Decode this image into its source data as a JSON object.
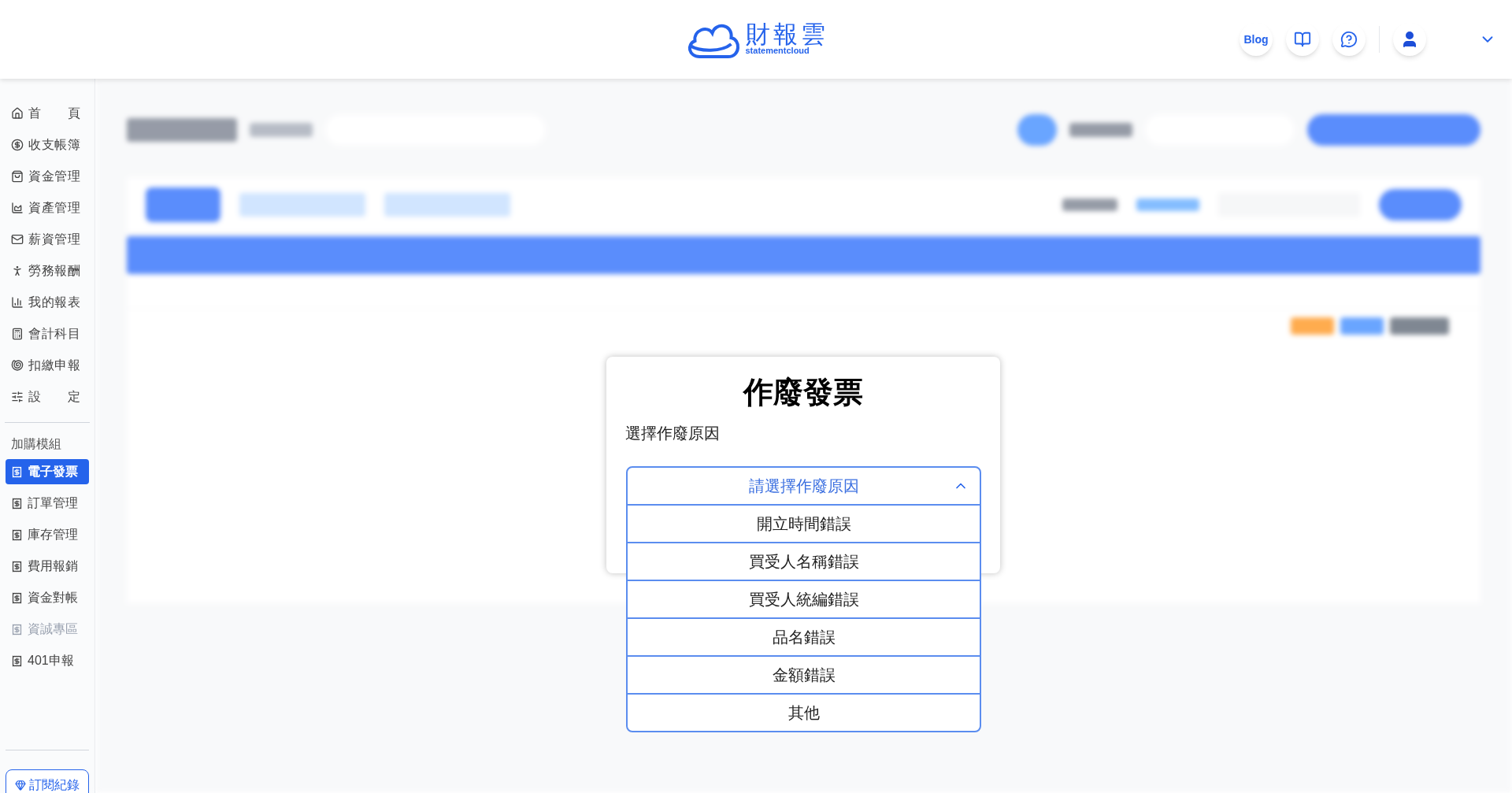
{
  "header": {
    "logo_name": "財報雲",
    "logo_sub": "statementcloud",
    "blog": "Blog"
  },
  "sidebar": {
    "items": [
      {
        "label": "首 頁",
        "selected": false,
        "disabled": false
      },
      {
        "label": "收支帳簿",
        "selected": false,
        "disabled": false
      },
      {
        "label": "資金管理",
        "selected": false,
        "disabled": false
      },
      {
        "label": "資產管理",
        "selected": false,
        "disabled": false
      },
      {
        "label": "薪資管理",
        "selected": false,
        "disabled": false
      },
      {
        "label": "勞務報酬",
        "selected": false,
        "disabled": false
      },
      {
        "label": "我的報表",
        "selected": false,
        "disabled": false
      },
      {
        "label": "會計科目",
        "selected": false,
        "disabled": false
      },
      {
        "label": "扣繳申報",
        "selected": false,
        "disabled": false
      },
      {
        "label": "設 定",
        "selected": false,
        "disabled": false
      }
    ],
    "module_heading": "加購模組",
    "modules": [
      {
        "label": "電子發票",
        "selected": true,
        "disabled": false
      },
      {
        "label": "訂單管理",
        "selected": false,
        "disabled": false
      },
      {
        "label": "庫存管理",
        "selected": false,
        "disabled": false
      },
      {
        "label": "費用報銷",
        "selected": false,
        "disabled": false
      },
      {
        "label": "資金對帳",
        "selected": false,
        "disabled": false
      },
      {
        "label": "資誠專區",
        "selected": false,
        "disabled": true
      },
      {
        "label": "401申報",
        "selected": false,
        "disabled": false
      }
    ],
    "subscription": "訂閱紀錄"
  },
  "dialog": {
    "title": "作廢發票",
    "field_label": "選擇作廢原因",
    "dropdown": {
      "placeholder": "請選擇作廢原因",
      "expanded": true,
      "options": [
        {
          "label": "開立時間錯誤",
          "selected": false
        },
        {
          "label": "買受人名稱錯誤",
          "selected": false
        },
        {
          "label": "買受人統編錯誤",
          "selected": false
        },
        {
          "label": "品名錯誤",
          "selected": false
        },
        {
          "label": "金額錯誤",
          "selected": false
        },
        {
          "label": "其他",
          "selected": false
        }
      ]
    }
  }
}
